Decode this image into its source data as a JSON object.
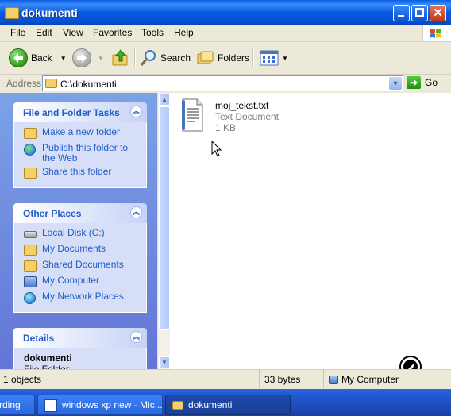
{
  "window": {
    "title": "dokumenti"
  },
  "menu": [
    "File",
    "Edit",
    "View",
    "Favorites",
    "Tools",
    "Help"
  ],
  "toolbar": {
    "back_label": "Back",
    "search_label": "Search",
    "folders_label": "Folders"
  },
  "address": {
    "label": "Address",
    "value": "C:\\dokumenti",
    "go_label": "Go"
  },
  "left_pane": {
    "tasks": {
      "title": "File and Folder Tasks",
      "items": [
        "Make a new folder",
        "Publish this folder to the Web",
        "Share this folder"
      ]
    },
    "other_places": {
      "title": "Other Places",
      "items": [
        "Local Disk (C:)",
        "My Documents",
        "Shared Documents",
        "My Computer",
        "My Network Places"
      ]
    },
    "details": {
      "title": "Details",
      "name": "dokumenti",
      "type": "File Folder"
    }
  },
  "file": {
    "name": "moj_tekst.txt",
    "type": "Text Document",
    "size": "1 KB"
  },
  "status": {
    "objects": "1 objects",
    "bytes": "33 bytes",
    "zone": "My Computer"
  },
  "taskbar": {
    "tasks": [
      "rding",
      "windows xp new - Mic...",
      "dokumenti"
    ]
  }
}
